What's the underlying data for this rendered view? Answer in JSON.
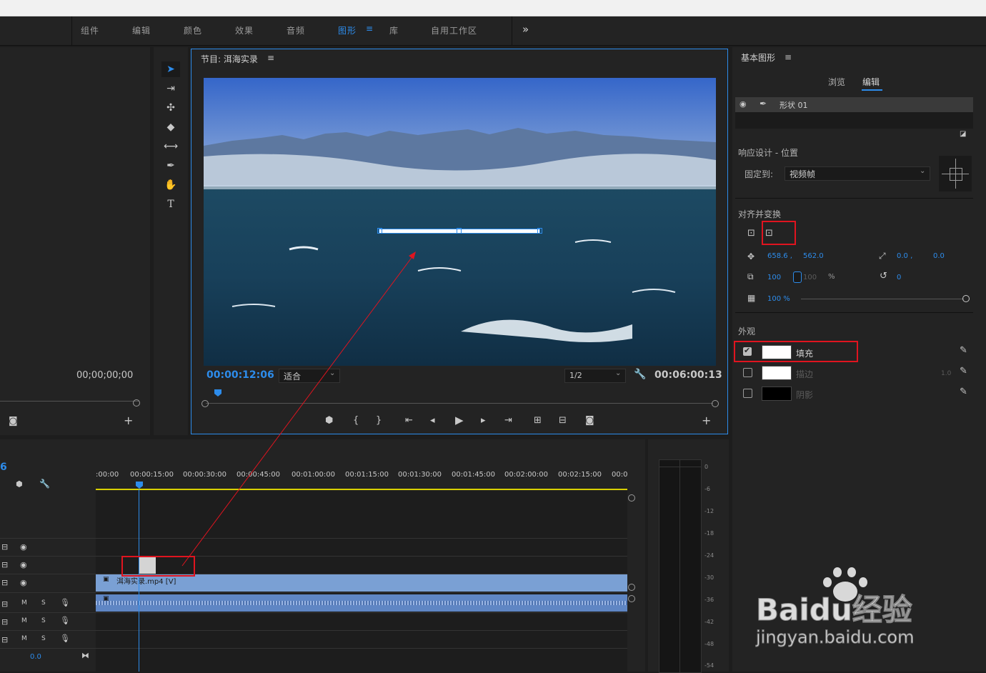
{
  "workspaces": [
    "组件",
    "编辑",
    "颜色",
    "效果",
    "音频",
    "图形",
    "库",
    "自用工作区"
  ],
  "workspace_active_index": 5,
  "workspace_overflow": "»",
  "program": {
    "title": "节目: 洱海实录",
    "menu_icon": "≡",
    "timecode_current": "00:00:12:06",
    "fit_label": "适合",
    "resolution_label": "1/2",
    "timecode_total": "00:06:00:13"
  },
  "source": {
    "timecode": "00;00;00;00"
  },
  "essential_graphics": {
    "title": "基本图形",
    "tabs": [
      "浏览",
      "编辑"
    ],
    "active_tab": "编辑",
    "layer_name": "形状 01",
    "responsive_design_label": "响应设计 - 位置",
    "pin_to_label": "固定到:",
    "pin_to_value": "视频帧",
    "align_label": "对齐并变换",
    "position_x": "658.6 ,",
    "position_y": "562.0",
    "anchor_x": "0.0 ,",
    "anchor_y": "0.0",
    "scale": "100",
    "scale_dim": "100",
    "scale_unit": "%",
    "rotation": "0",
    "opacity": "100 %",
    "appearance_label": "外观",
    "fill_label": "填充",
    "stroke_label": "描边",
    "stroke_width": "1.0",
    "shadow_label": "阴影",
    "fill_color": "#ffffff",
    "stroke_color": "#ffffff",
    "shadow_color": "#000000"
  },
  "timeline": {
    "seq_number": "6",
    "ruler_labels": [
      ":00:00",
      "00:00:15:00",
      "00:00:30:00",
      "00:00:45:00",
      "00:01:00:00",
      "00:01:15:00",
      "00:01:30:00",
      "00:01:45:00",
      "00:02:00:00",
      "00:02:15:00",
      "00:0"
    ],
    "video_clip_label": "洱海实录.mp4 [V]",
    "audio_track_m": "M",
    "audio_track_s": "S",
    "volume_value": "0.0"
  },
  "audio_meter": {
    "labels": [
      "0",
      "-6",
      "-12",
      "-18",
      "-24",
      "-30",
      "-36",
      "-42",
      "-48",
      "-54"
    ]
  },
  "watermark": {
    "brand": "Baidu经验",
    "url": "jingyan.baidu.com"
  },
  "colors": {
    "accent": "#2d8ceb",
    "highlight": "#e0141f",
    "clip_video": "#7aa0d4",
    "clip_audio": "#5f86c4",
    "playhead_line": "#2d8ceb"
  }
}
